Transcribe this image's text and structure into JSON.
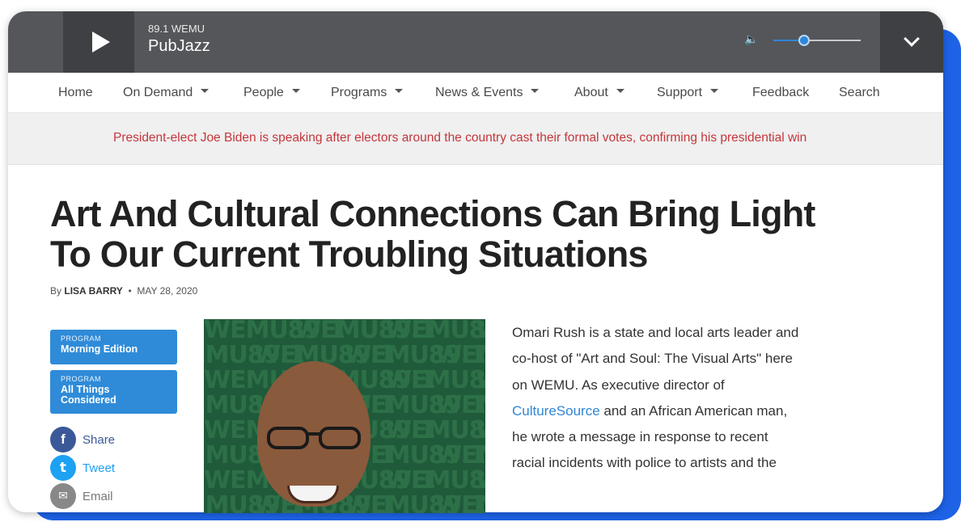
{
  "player": {
    "station": "89.1 WEMU",
    "stream": "PubJazz",
    "volume": 0.35,
    "icons": {
      "play": "play-icon",
      "volume": "volume-icon",
      "expand": "chevron-down-icon"
    }
  },
  "nav": {
    "items": [
      {
        "label": "Home",
        "dropdown": false
      },
      {
        "label": "On Demand",
        "dropdown": true
      },
      {
        "label": "People",
        "dropdown": true
      },
      {
        "label": "Programs",
        "dropdown": true
      },
      {
        "label": "News & Events",
        "dropdown": true
      },
      {
        "label": "About",
        "dropdown": true
      },
      {
        "label": "Support",
        "dropdown": true
      },
      {
        "label": "Feedback",
        "dropdown": false
      },
      {
        "label": "Search",
        "dropdown": false
      }
    ]
  },
  "breaking": {
    "text": "President-elect Joe Biden is speaking after electors around the country cast their formal votes, confirming his presidential win"
  },
  "article": {
    "title_line1": "Art And Cultural Connections Can Bring Light",
    "title_line2": "To Our Current Troubling Situations",
    "by": "By",
    "author": "Lisa Barry",
    "separator": "•",
    "date": "MAY 28, 2020",
    "programs": [
      {
        "kicker": "PROGRAM",
        "name": "Morning Edition"
      },
      {
        "kicker": "PROGRAM",
        "name_line1": "All Things",
        "name_line2": "Considered"
      }
    ],
    "share": [
      {
        "label": "Share",
        "icon": "facebook-icon",
        "glyph": "f",
        "color": "#3b5998"
      },
      {
        "label": "Tweet",
        "icon": "twitter-icon",
        "glyph": "t",
        "color": "#1da1f2"
      },
      {
        "label": "Email",
        "icon": "email-icon",
        "glyph": "✉",
        "color": "#888888"
      }
    ],
    "photo_watermark": "WEMU",
    "photo_watermark_num": "89.1",
    "body_1": "Omari Rush is a state and local arts leader and co-host of \"Art and Soul: The Visual Arts\" here on WEMU.  As executive director of ",
    "body_link": "CultureSource",
    "body_2": " and an African American man, he wrote a message in response to recent racial incidents with police to artists and the"
  },
  "colors": {
    "player_bg": "#54565a",
    "accent_blue": "#2f8bd8",
    "breaking_red": "#c4363b",
    "frame_blue": "#1e62e6"
  }
}
